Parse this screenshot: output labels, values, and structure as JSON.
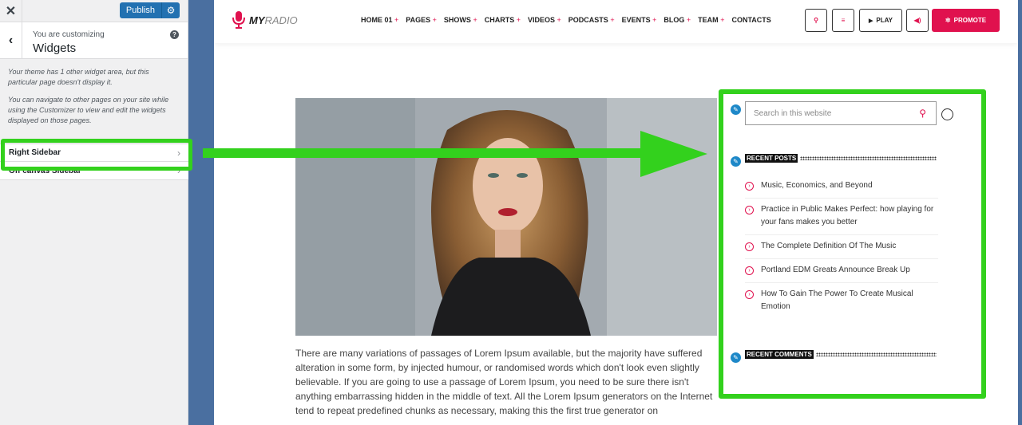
{
  "customizer": {
    "close_label": "✕",
    "publish_label": "Publish",
    "publish_gear_icon": "gear-icon",
    "header_subtitle": "You are customizing",
    "header_title": "Widgets",
    "back_icon": "chevron-left-icon",
    "help_icon": "question-icon",
    "notice_1": "Your theme has 1 other widget area, but this particular page doesn't display it.",
    "notice_2": "You can navigate to other pages on your site while using the Customizer to view and edit the widgets displayed on those pages.",
    "sections": [
      {
        "label": "Right Sidebar"
      },
      {
        "label": "Off canvas Sidebar"
      }
    ]
  },
  "site": {
    "logo_bold": "MY",
    "logo_light": "RADIO",
    "nav": [
      {
        "label": "HOME 01",
        "plus": "+"
      },
      {
        "label": "PAGES",
        "plus": "+"
      },
      {
        "label": "SHOWS",
        "plus": "+"
      },
      {
        "label": "CHARTS",
        "plus": "+"
      },
      {
        "label": "VIDEOS",
        "plus": "+"
      },
      {
        "label": "PODCASTS",
        "plus": "+"
      },
      {
        "label": "EVENTS",
        "plus": "+"
      },
      {
        "label": "BLOG",
        "plus": "+"
      },
      {
        "label": "TEAM",
        "plus": "+"
      },
      {
        "label": "CONTACTS",
        "plus": ""
      }
    ],
    "play_label": "PLAY",
    "promote_label": "PROMOTE",
    "body_text": "There are many variations of passages of Lorem Ipsum available, but the majority have suffered alteration in some form, by injected humour, or randomised words which don't look even slightly believable. If you are going to use a passage of Lorem Ipsum, you need to be sure there isn't anything embarrassing hidden in the middle of text. All the Lorem Ipsum generators on the Internet tend to repeat predefined chunks as necessary, making this the first true generator on",
    "sidebar": {
      "search_placeholder": "Search in this website",
      "recent_posts_title": "RECENT POSTS",
      "posts": [
        {
          "title": "Music, Economics, and Beyond"
        },
        {
          "title": "Practice in Public Makes Perfect: how playing for your fans makes you better"
        },
        {
          "title": "The Complete Definition Of The Music"
        },
        {
          "title": "Portland EDM Greats Announce Break Up"
        },
        {
          "title": "How To Gain The Power To Create Musical Emotion"
        }
      ],
      "recent_comments_title": "RECENT COMMENTS"
    }
  },
  "colors": {
    "accent": "#e0114e",
    "highlight": "#33d11d",
    "wp_blue": "#2271b1"
  }
}
